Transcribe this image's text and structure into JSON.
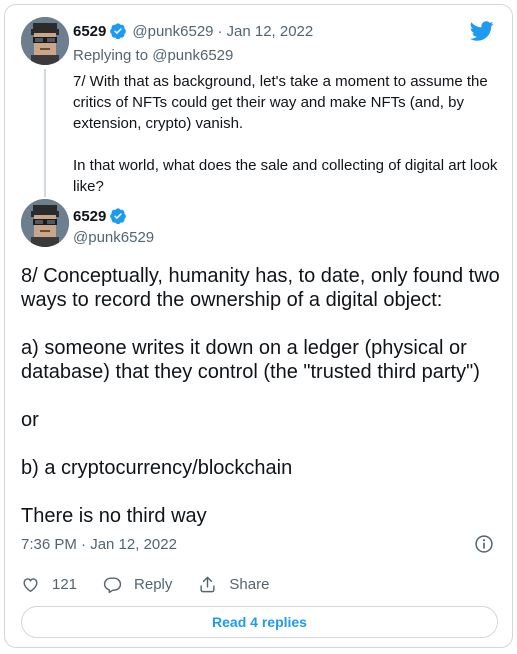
{
  "brand": {
    "icon": "twitter-bird-icon",
    "color": "#1d9bf0"
  },
  "parent_tweet": {
    "display_name": "6529",
    "handle": "@punk6529",
    "separator": "·",
    "date": "Jan 12, 2022",
    "replying_prefix": "Replying to",
    "replying_to": "@punk6529",
    "paragraphs": [
      "7/ With that as background, let's take a moment to assume the critics of NFTs could get their way and make NFTs (and, by extension, crypto) vanish.",
      "In that world, what does the sale and collecting of digital art look like?"
    ]
  },
  "main_tweet": {
    "display_name": "6529",
    "handle": "@punk6529",
    "paragraphs": [
      "8/ Conceptually, humanity has, to date, only found two ways to record the ownership of a digital object:",
      "a) someone writes it down on a ledger (physical or database) that they control (the \"trusted third party\")",
      "or",
      "b) a cryptocurrency/blockchain",
      "There is no third way"
    ],
    "timestamp": "7:36 PM · Jan 12, 2022",
    "likes": "121",
    "reply_label": "Reply",
    "share_label": "Share",
    "read_replies_label": "Read 4 replies"
  },
  "colors": {
    "verified": "#1d9bf0",
    "muted_text": "#536471",
    "link": "#1d9bf0"
  }
}
